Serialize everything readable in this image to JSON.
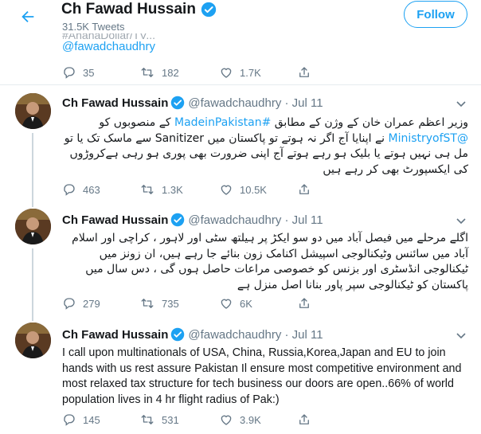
{
  "header": {
    "name": "Ch Fawad Hussain",
    "tweet_count": "31.5K Tweets",
    "follow_label": "Follow"
  },
  "partial_tweet": {
    "cutoff_text": "#AhanaDollar/TV...",
    "handle_link": "@fawadchaudhry",
    "replies": "35",
    "retweets": "182",
    "likes": "1.7K"
  },
  "tweets": [
    {
      "name": "Ch Fawad Hussain",
      "meta": "@fawadchaudhry · Jul 11",
      "text_parts": [
        "وزیر اعظم عمران خان کے وژن کے مطابق ",
        "#MadeinPakistan",
        " کے منصوبوں کو ",
        "@MinistryofST",
        " نے اپنایا آج اگر نہ ہوتے تو پاکستان میں Sanitizer سے ماسک تک یا تو مل ہی نہیں ہوتے یا بلیک ہو رہے ہوتے آج اپنی ضرورت بھی پوری ہو رہی ہےکروڑوں کی ایکسپورٹ بھی کر رہے ہیں"
      ],
      "replies": "463",
      "retweets": "1.3K",
      "likes": "10.5K"
    },
    {
      "name": "Ch Fawad Hussain",
      "meta": "@fawadchaudhry · Jul 11",
      "text": "اگلے مرحلے میں فیصل آباد میں دو سو ایکڑ پر ہیلتھ سٹی اور لاہور ، کراچی اور اسلام آباد میں سائنس وٹیکنالوجی اسپیشل اکنامک زون بنائے جا رہے ہیں، ان زونز میں ٹیکنالوجی انڈسٹری اور بزنس کو خصوصی مراعات حاصل ہوں گی ، دس سال میں پاکستان کو ٹیکنالوجی سپر پاور بنانا اصل منزل ہے",
      "replies": "279",
      "retweets": "735",
      "likes": "6K"
    },
    {
      "name": "Ch Fawad Hussain",
      "meta": "@fawadchaudhry · Jul 11",
      "text": "I call upon multinationals of USA, China, Russia,Korea,Japan and EU to join hands with us rest assure Pakistan Il ensure most competitive environment and most relaxed tax structure for tech business our doors are open..66% of world population lives in 4 hr flight radius of Pak:)",
      "replies": "145",
      "retweets": "531",
      "likes": "3.9K"
    }
  ],
  "colors": {
    "accent": "#1da1f2",
    "text": "#14171a",
    "secondary": "#657786",
    "divider": "#e6ecf0",
    "thread_line": "#ccd6dd"
  },
  "icons": [
    "back-arrow-icon",
    "verified-badge-icon",
    "reply-icon",
    "retweet-icon",
    "like-icon",
    "share-icon",
    "caret-down-icon"
  ]
}
